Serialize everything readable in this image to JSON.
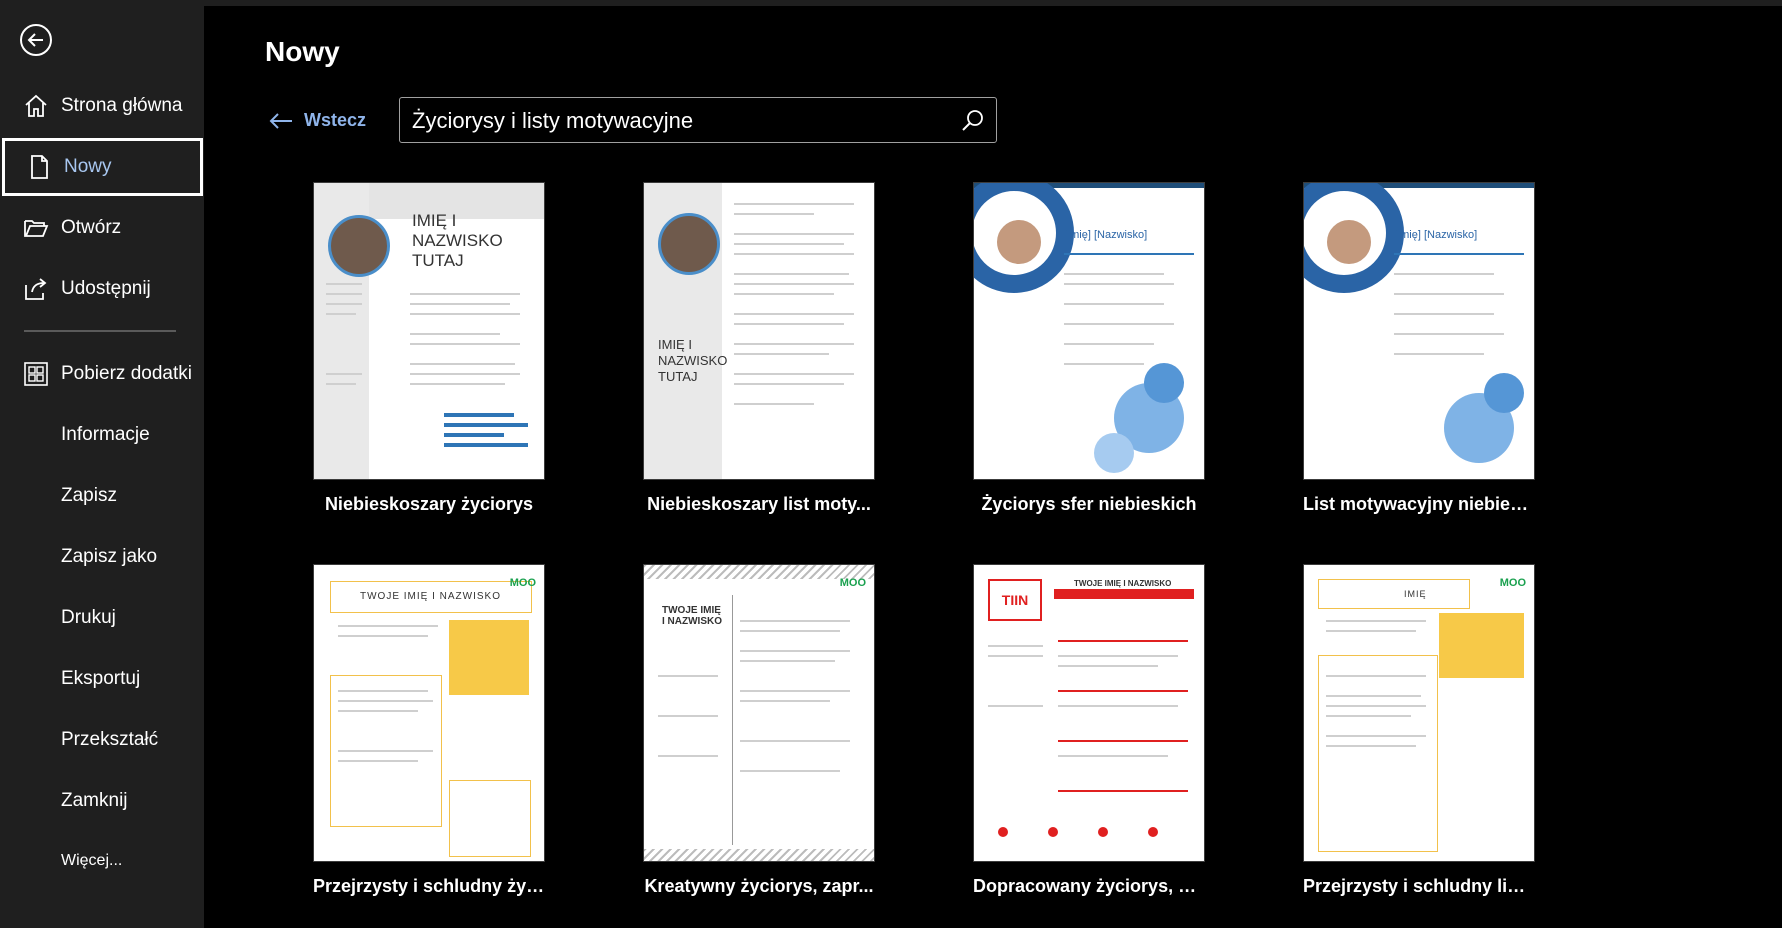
{
  "window": {
    "page_title": "Nowy"
  },
  "sidebar": {
    "items": [
      {
        "label": "Strona główna",
        "icon": "home-icon"
      },
      {
        "label": "Nowy",
        "icon": "new-document-icon",
        "active": true
      },
      {
        "label": "Otwórz",
        "icon": "folder-open-icon"
      },
      {
        "label": "Udostępnij",
        "icon": "share-icon"
      },
      {
        "label": "Pobierz dodatki",
        "icon": "add-ins-icon"
      },
      {
        "label": "Informacje"
      },
      {
        "label": "Zapisz"
      },
      {
        "label": "Zapisz jako"
      },
      {
        "label": "Drukuj"
      },
      {
        "label": "Eksportuj"
      },
      {
        "label": "Przekształć"
      },
      {
        "label": "Zamknij"
      },
      {
        "label": "Więcej..."
      }
    ]
  },
  "toolbar": {
    "back_label": "Wstecz"
  },
  "search": {
    "value": "Życiorysy i listy motywacyjne"
  },
  "templates": [
    {
      "label": "Niebieskoszary życiorys",
      "thumb_text": "IMIĘ I NAZWISKO TUTAJ"
    },
    {
      "label": "Niebieskoszary list moty...",
      "thumb_text": "IMIĘ I NAZWISKO TUTAJ"
    },
    {
      "label": "Życiorys sfer niebieskich",
      "thumb_text": "[Imię] [Nazwisko]"
    },
    {
      "label": "List motywacyjny niebies...",
      "thumb_text": "[Imię] [Nazwisko]"
    },
    {
      "label": "Przejrzysty i schludny życi...",
      "thumb_text": "TWOJE IMIĘ I NAZWISKO",
      "badge": "MOO"
    },
    {
      "label": "Kreatywny życiorys, zapr...",
      "thumb_text": "TWOJE IMIĘ I NAZWISKO",
      "badge": "MOO"
    },
    {
      "label": "Dopracowany życiorys, za...",
      "thumb_text": "TWOJE IMIĘ I NAZWISKO",
      "badge_red": "TIIN"
    },
    {
      "label": "Przejrzysty i schludny list...",
      "thumb_text": "IMIĘ",
      "badge": "MOO"
    }
  ],
  "colors": {
    "accent": "#8fb4ea",
    "sidebar_bg": "#1f1f1f",
    "page_bg": "#000000"
  }
}
